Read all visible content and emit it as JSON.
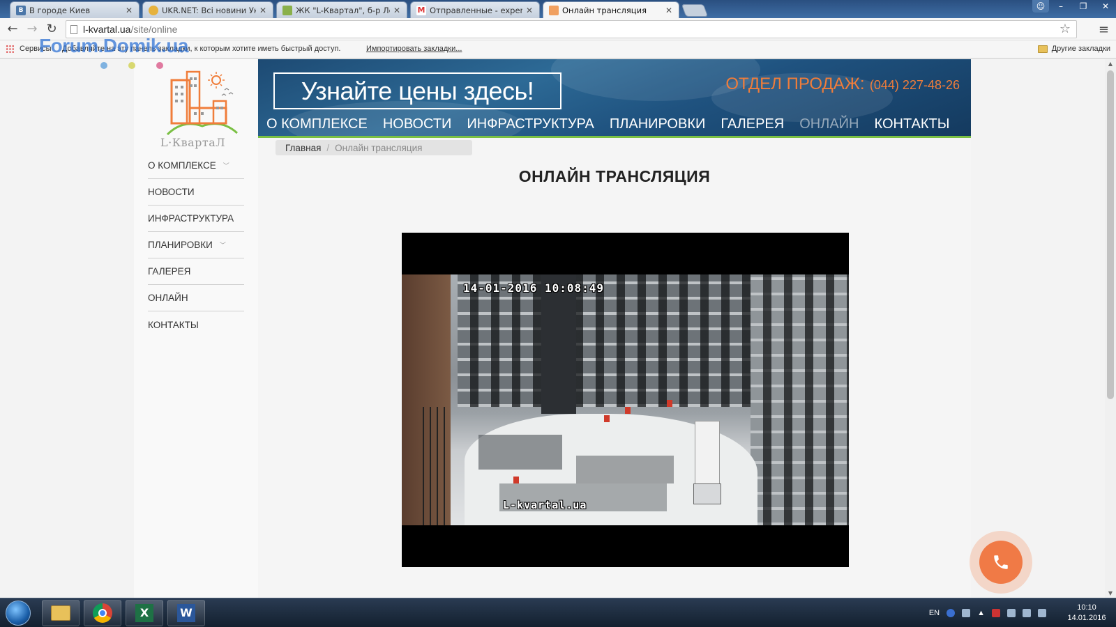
{
  "browser": {
    "tabs": [
      {
        "label": "В городе Киев",
        "favicon": "vk-icon",
        "active": false
      },
      {
        "label": "UKR.NET: Всі новини Укра",
        "favicon": "ukrnet-icon",
        "active": false
      },
      {
        "label": "ЖК \"L-Квартал\", б-р Лепс",
        "favicon": "forum-icon",
        "active": false
      },
      {
        "label": "Отправленные - expert.or",
        "favicon": "gmail-icon",
        "active": false
      },
      {
        "label": "Онлайн трансляция",
        "favicon": "lkvartal-icon",
        "active": true
      }
    ],
    "url_host": "l-kvartal.ua",
    "url_path": "/site/online",
    "bookmarks": {
      "services_label": "Сервисы",
      "hint": "Добавляйте на эту панель закладки, к которым хотите иметь быстрый доступ.",
      "import_link": "Импортировать закладки...",
      "other_label": "Другие закладки"
    },
    "watermark": "Forum.Domik.ua"
  },
  "site": {
    "logo_text": "L·КвартаЛ",
    "promo": "Узнайте цены здесь!",
    "sales_label": "ОТДЕЛ ПРОДАЖ:",
    "sales_phone": "(044) 227-48-26",
    "top_nav": [
      {
        "label": "О КОМПЛЕКСЕ",
        "active": false
      },
      {
        "label": "НОВОСТИ",
        "active": false
      },
      {
        "label": "ИНФРАСТРУКТУРА",
        "active": false
      },
      {
        "label": "ПЛАНИРОВКИ",
        "active": false
      },
      {
        "label": "ГАЛЕРЕЯ",
        "active": false
      },
      {
        "label": "ОНЛАЙН",
        "active": true
      },
      {
        "label": "КОНТАКТЫ",
        "active": false
      }
    ],
    "side_nav": [
      {
        "label": "О КОМПЛЕКСЕ",
        "has_submenu": true
      },
      {
        "label": "НОВОСТИ",
        "has_submenu": false
      },
      {
        "label": "ИНФРАСТРУКТУРА",
        "has_submenu": false
      },
      {
        "label": "ПЛАНИРОВКИ",
        "has_submenu": true
      },
      {
        "label": "ГАЛЕРЕЯ",
        "has_submenu": false
      },
      {
        "label": "ОНЛАЙН",
        "has_submenu": false
      },
      {
        "label": "КОНТАКТЫ",
        "has_submenu": false
      }
    ],
    "breadcrumb": {
      "home": "Главная",
      "current": "Онлайн трансляция"
    },
    "page_title": "ОНЛАЙН ТРАНСЛЯЦИЯ",
    "video": {
      "timestamp": "14-01-2016 10:08:49",
      "overlay_site": "L-kvartal.ua"
    },
    "colors": {
      "accent_orange": "#f07d3a",
      "nav_green": "#7ac043",
      "header_blue": "#1f527f",
      "dot_blue": "#7fb2e0",
      "dot_yellow": "#d8d870",
      "dot_pink": "#e07aa0"
    }
  },
  "taskbar": {
    "apps": [
      "explorer-icon",
      "chrome-icon",
      "excel-icon",
      "word-icon"
    ],
    "language": "EN",
    "time": "10:10",
    "date": "14.01.2016"
  }
}
